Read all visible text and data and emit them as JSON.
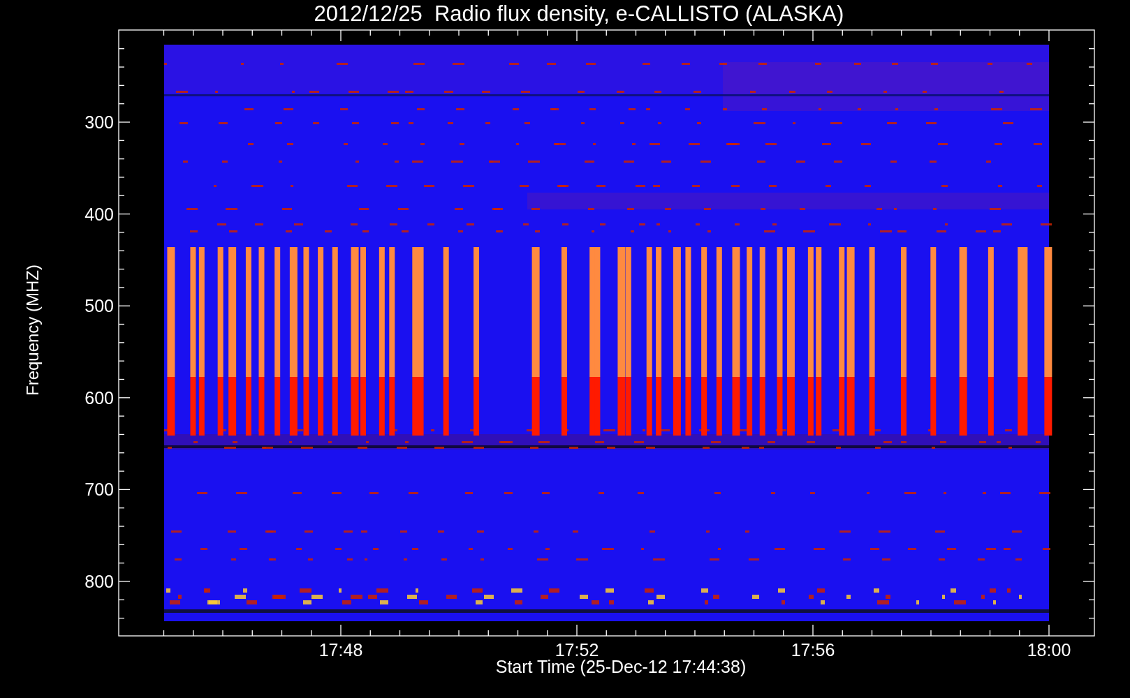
{
  "title": "2012/12/25  Radio flux density, e-CALLISTO (ALASKA)",
  "y_axis": {
    "label": "Frequency (MHZ)",
    "tick_labels": [
      "300",
      "400",
      "500",
      "600",
      "700",
      "800"
    ]
  },
  "x_axis": {
    "label": "Start Time (25-Dec-12 17:44:38)",
    "tick_labels": [
      "17:48",
      "17:52",
      "17:56",
      "18:00"
    ]
  }
}
